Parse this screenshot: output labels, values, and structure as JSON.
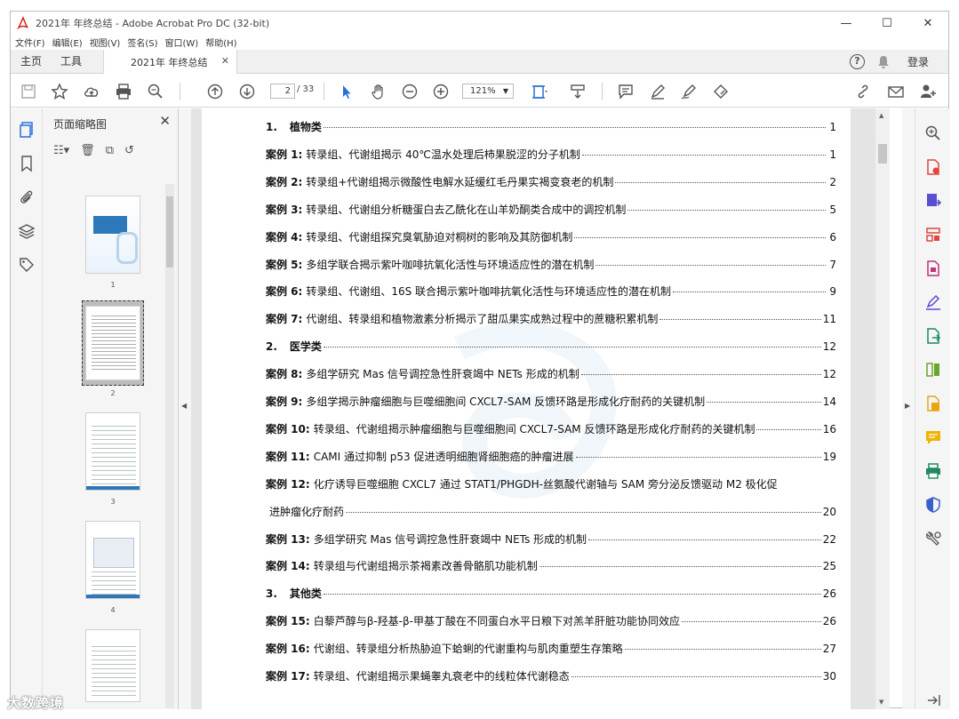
{
  "window": {
    "title": "2021年 年终总结 - Adobe Acrobat Pro DC (32-bit)"
  },
  "menu": [
    "文件(F)",
    "编辑(E)",
    "视图(V)",
    "签名(S)",
    "窗口(W)",
    "帮助(H)"
  ],
  "tabs": {
    "home": "主页",
    "tools": "工具",
    "doc": "2021年 年终总结"
  },
  "header_right": {
    "login": "登录"
  },
  "toolbar": {
    "page_current": "2",
    "page_total": "/ 33",
    "zoom": "121%"
  },
  "thumbs": {
    "title": "页面缩略图",
    "pages": [
      "1",
      "2",
      "3",
      "4"
    ]
  },
  "toc": [
    {
      "label": "1.",
      "text": "植物类",
      "page": "1",
      "section": true
    },
    {
      "label": "案例 1:",
      "text": "转录组、代谢组揭示 40℃温水处理后柿果脱涩的分子机制",
      "page": "1"
    },
    {
      "label": "案例 2:",
      "text": "转录组+代谢组揭示微酸性电解水延缓红毛丹果实褐变衰老的机制",
      "page": "2"
    },
    {
      "label": "案例 3:",
      "text": "转录组、代谢组分析糖蛋白去乙酰化在山羊奶酮类合成中的调控机制",
      "page": "5"
    },
    {
      "label": "案例 4:",
      "text": "转录组、代谢组探究臭氧胁迫对桐树的影响及其防御机制",
      "page": "6"
    },
    {
      "label": "案例 5:",
      "text": "多组学联合揭示紫叶咖啡抗氧化活性与环境适应性的潜在机制",
      "page": "7"
    },
    {
      "label": "案例 6:",
      "text": "转录组、代谢组、16S 联合揭示紫叶咖啡抗氧化活性与环境适应性的潜在机制",
      "page": "9"
    },
    {
      "label": "案例 7:",
      "text": "代谢组、转录组和植物激素分析揭示了甜瓜果实成熟过程中的蔗糖积累机制",
      "page": "11"
    },
    {
      "label": "2.",
      "text": "医学类",
      "page": "12",
      "section": true
    },
    {
      "label": "案例 8:",
      "text": "多组学研究 Mas 信号调控急性肝衰竭中 NETs 形成的机制",
      "page": "12"
    },
    {
      "label": "案例 9:",
      "text": "多组学揭示肿瘤细胞与巨噬细胞间 CXCL7-SAM 反馈环路是形成化疗耐药的关键机制",
      "page": "14"
    },
    {
      "label": "案例 10:",
      "text": "转录组、代谢组揭示肿瘤细胞与巨噬细胞间 CXCL7-SAM 反馈环路是形成化疗耐药的关键机制",
      "page": "16"
    },
    {
      "label": "案例 11:",
      "text": "CAMI 通过抑制 p53 促进透明细胞肾细胞癌的肿瘤进展",
      "page": "19"
    },
    {
      "label": "案例 12:",
      "text": "化疗诱导巨噬细胞 CXCL7 通过 STAT1/PHGDH-丝氨酸代谢轴与 SAM 旁分泌反馈驱动 M2 极化促",
      "page": ""
    },
    {
      "label": "",
      "text": "进肿瘤化疗耐药",
      "page": "20"
    },
    {
      "label": "案例 13:",
      "text": "多组学研究 Mas 信号调控急性肝衰竭中 NETs 形成的机制",
      "page": "22"
    },
    {
      "label": "案例 14:",
      "text": "转录组与代谢组揭示茶褐素改善骨骼肌功能机制",
      "page": "25"
    },
    {
      "label": "3.",
      "text": "其他类",
      "page": "26",
      "section": true
    },
    {
      "label": "案例 15:",
      "text": "白藜芦醇与β-羟基-β-甲基丁酸在不同蛋白水平日粮下对羔羊肝脏功能协同效应",
      "page": "26"
    },
    {
      "label": "案例 16:",
      "text": "代谢组、转录组分析热胁迫下蛤蜊的代谢重构与肌肉重塑生存策略",
      "page": "27"
    },
    {
      "label": "案例 17:",
      "text": "转录组、代谢组揭示果蝇睾丸衰老中的线粒体代谢稳态",
      "page": "30"
    }
  ],
  "brand": "大数跨境"
}
